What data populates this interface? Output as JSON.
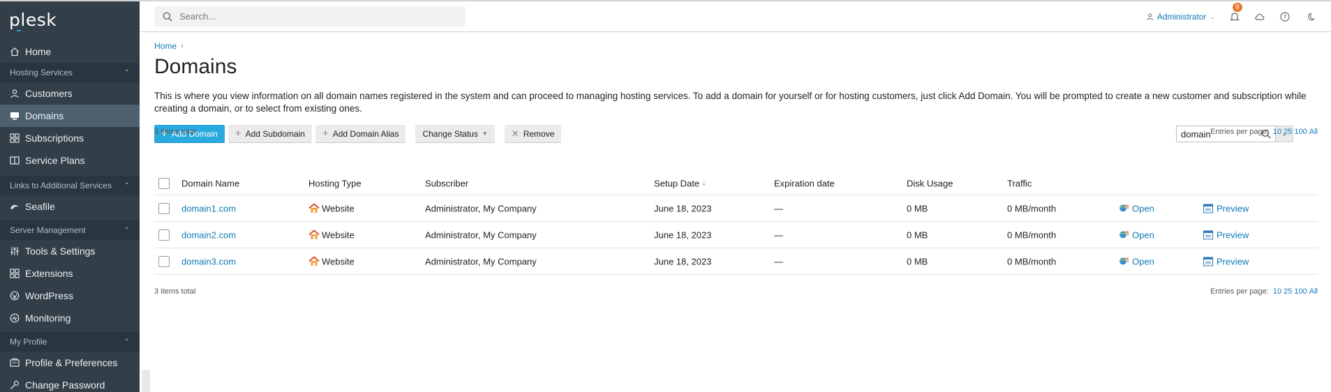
{
  "sidebar": {
    "logo": "plesk",
    "home": "Home",
    "sections": {
      "hosting": "Hosting Services",
      "links": "Links to Additional Services",
      "server": "Server Management",
      "profile": "My Profile"
    },
    "items": {
      "customers": "Customers",
      "domains": "Domains",
      "subscriptions": "Subscriptions",
      "service_plans": "Service Plans",
      "seafile": "Seafile",
      "tools": "Tools & Settings",
      "extensions": "Extensions",
      "wordpress": "WordPress",
      "monitoring": "Monitoring",
      "profile_prefs": "Profile & Preferences",
      "change_password": "Change Password"
    }
  },
  "header": {
    "search_placeholder": "Search...",
    "user": "Administrator",
    "notifications_count": "9"
  },
  "breadcrumb": {
    "home": "Home"
  },
  "page": {
    "title": "Domains",
    "description": "This is where you view information on all domain names registered in the system and can proceed to managing hosting services. To add a domain for yourself or for hosting customers, just click Add Domain. You will be prompted to create a new customer and subscription while creating a domain, or to select from existing ones."
  },
  "toolbar": {
    "add_domain": "Add Domain",
    "add_subdomain": "Add Subdomain",
    "add_alias": "Add Domain Alias",
    "change_status": "Change Status",
    "remove": "Remove"
  },
  "filter": {
    "value": "domain"
  },
  "list_meta": {
    "total": "3 items total",
    "entries_label": "Entries per page:",
    "opt10": "10",
    "opt25": "25",
    "opt100": "100",
    "optAll": "All"
  },
  "table": {
    "columns": {
      "name": "Domain Name",
      "hosting": "Hosting Type",
      "subscriber": "Subscriber",
      "setup": "Setup Date",
      "expiration": "Expiration date",
      "disk": "Disk Usage",
      "traffic": "Traffic"
    },
    "open_label": "Open",
    "preview_label": "Preview",
    "rows": [
      {
        "name": "domain1.com",
        "hosting": "Website",
        "subscriber": "Administrator, My Company",
        "setup": "June 18, 2023",
        "expiration": "—",
        "disk": "0 MB",
        "traffic": "0 MB/month"
      },
      {
        "name": "domain2.com",
        "hosting": "Website",
        "subscriber": "Administrator, My Company",
        "setup": "June 18, 2023",
        "expiration": "—",
        "disk": "0 MB",
        "traffic": "0 MB/month"
      },
      {
        "name": "domain3.com",
        "hosting": "Website",
        "subscriber": "Administrator, My Company",
        "setup": "June 18, 2023",
        "expiration": "—",
        "disk": "0 MB",
        "traffic": "0 MB/month"
      }
    ]
  },
  "colors": {
    "accent": "#28aade",
    "sidebar": "#323e48",
    "link": "#0f7ab5",
    "badge": "#e8762d"
  }
}
